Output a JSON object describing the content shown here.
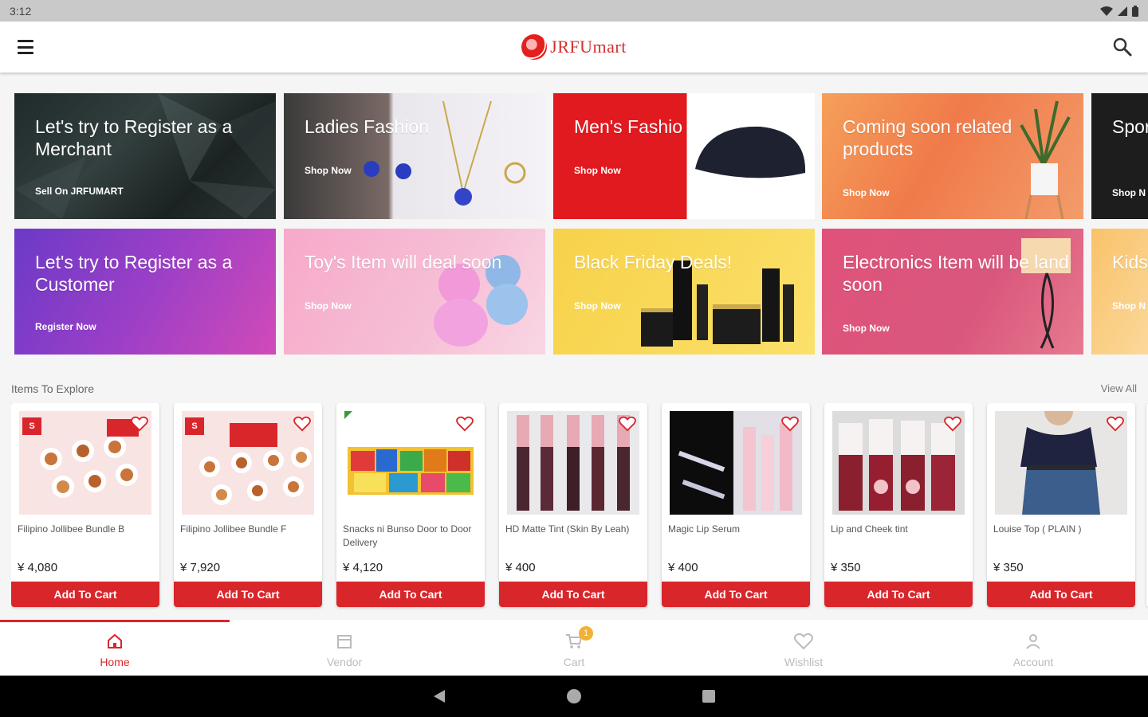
{
  "status": {
    "time": "3:12"
  },
  "header": {
    "logo_text": "JRFUmart"
  },
  "banners": [
    {
      "title": "Let's try to Register as a Merchant",
      "cta": "Sell On JRFUMART"
    },
    {
      "title": "Ladies Fashion",
      "cta": "Shop Now"
    },
    {
      "title": "Men's Fashio",
      "cta": "Shop Now"
    },
    {
      "title": "Coming soon related products",
      "cta": "Shop Now"
    },
    {
      "title": "Spor soon",
      "cta": "Shop N"
    },
    {
      "title": "Let's try to Register as a Customer",
      "cta": "Register Now"
    },
    {
      "title": "Toy's Item will deal soon",
      "cta": "Shop Now"
    },
    {
      "title": "Black Friday Deals!",
      "cta": "Shop Now"
    },
    {
      "title": "Electronics Item will be land soon",
      "cta": "Shop Now"
    },
    {
      "title": "Kids",
      "cta": "Shop N"
    }
  ],
  "explore": {
    "title": "Items To Explore",
    "view_all": "View All"
  },
  "products": [
    {
      "name": "Filipino Jollibee Bundle B",
      "price": "¥ 4,080",
      "cta": "Add To Cart"
    },
    {
      "name": "Filipino Jollibee Bundle F",
      "price": "¥ 7,920",
      "cta": "Add To Cart"
    },
    {
      "name": "Snacks ni Bunso Door to Door Delivery",
      "price": "¥ 4,120",
      "cta": "Add To Cart"
    },
    {
      "name": "HD Matte Tint (Skin By Leah)",
      "price": "¥ 400",
      "cta": "Add To Cart"
    },
    {
      "name": "Magic Lip Serum",
      "price": "¥ 400",
      "cta": "Add To Cart"
    },
    {
      "name": "Lip and Cheek tint",
      "price": "¥ 350",
      "cta": "Add To Cart"
    },
    {
      "name": "Louise Top ( PLAIN )",
      "price": "¥ 350",
      "cta": "Add To Cart"
    }
  ],
  "nav": {
    "home": "Home",
    "vendor": "Vendor",
    "cart": "Cart",
    "cart_count": "1",
    "wishlist": "Wishlist",
    "account": "Account"
  },
  "colors": {
    "brand_red": "#d9262b",
    "badge_yellow": "#f2b134"
  }
}
